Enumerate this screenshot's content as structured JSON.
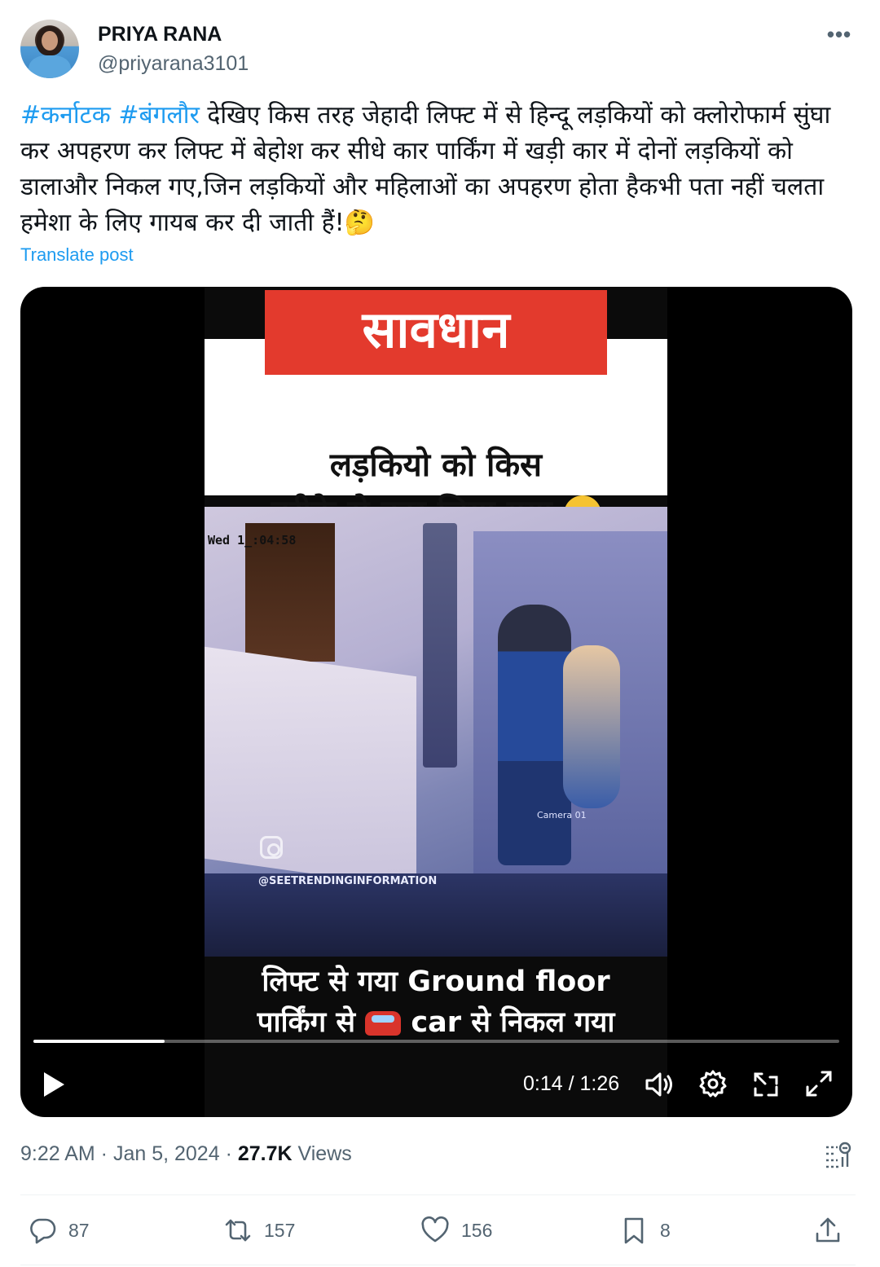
{
  "author": {
    "name": "PRIYA RANA",
    "handle": "@priyarana3101"
  },
  "post": {
    "hashtags": [
      "#कर्नाटक",
      "#बंगलौर"
    ],
    "text": "देखिए किस तरह जेहादी लिफ्ट में से हिन्दू लड़कियों को क्लोरोफार्म सुंघा कर अपहरण कर लिफ्ट में बेहोश कर सीधे कार पार्किंग में खड़ी कार में दोनों लड़कियों को डालाऔर निकल गए,जिन लड़कियों और महिलाओं का अपहरण होता हैकभी पता नहीं चलता हमेशा के लिए गायब कर दी जाती हैं!",
    "emoji": "🤔",
    "translate_label": "Translate post"
  },
  "video": {
    "banner": "सावधान",
    "headline_line1": "लड़कियो को किस",
    "headline_line2": "तरीके से उठा लिया गया",
    "cctv_timestamp": "Wed 1_:04:58",
    "camera_label": "Camera 01",
    "watermark": "@SEETRENDINGINFORMATION",
    "caption_line1": "लिफ्ट से गया Ground floor",
    "caption_line2_a": "पार्किंग से",
    "caption_line2_b": "car से निकल गया",
    "time_display": "0:14 / 1:26",
    "progress_fraction": 0.163
  },
  "meta": {
    "time": "9:22 AM",
    "date": "Jan 5, 2024",
    "views_count": "27.7K",
    "views_label": "Views"
  },
  "actions": {
    "replies": "87",
    "reposts": "157",
    "likes": "156",
    "bookmarks": "8"
  },
  "colors": {
    "accent": "#1d9bf0",
    "secondary_text": "#536471",
    "banner_red": "#e33a2d"
  }
}
